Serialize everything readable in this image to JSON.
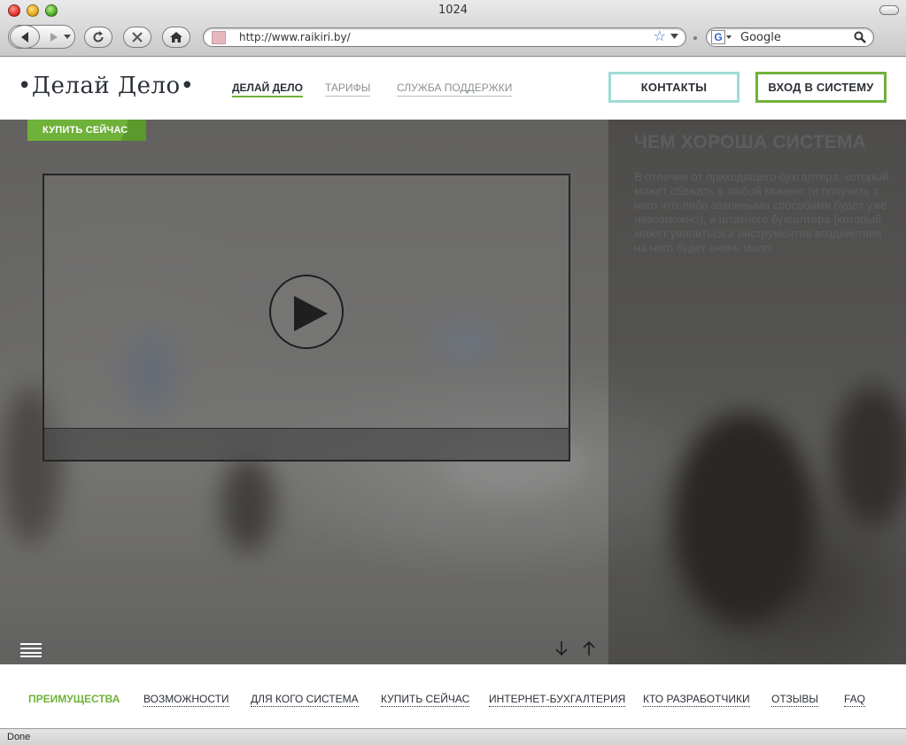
{
  "browser": {
    "window_title": "1024",
    "url": "http://www.raikiri.by/",
    "search_placeholder": "Google",
    "status": "Done"
  },
  "header": {
    "logo": "•Делай Дело•",
    "nav": [
      "ДЕЛАЙ ДЕЛО",
      "ТАРИФЫ",
      "СЛУЖБА ПОДДЕРЖКИ"
    ],
    "contacts_button": "КОНТАКТЫ",
    "login_button": "ВХОД В СИСТЕМУ"
  },
  "hero": {
    "buy_tag": "КУПИТЬ СЕЙЧАС",
    "panel_title": "ЧЕМ ХОРОША СИСТЕМА",
    "panel_text": "В отличие от приходящего бухгалтера, который может сбежать в любой момент (и получить с него что-либо законными способами будет уже невозможно), и штатного бухгалтера (который может уволиться и инструментов воздействия на него будет очень мало."
  },
  "footer_nav": [
    "ПРЕИМУЩЕСТВА",
    "ВОЗМОЖНОСТИ",
    "ДЛЯ КОГО  СИСТЕМА",
    "КУПИТЬ СЕЙЧАС",
    "ИНТЕРНЕТ-БУХГАЛТЕРИЯ",
    "КТО РАЗРАБОТЧИКИ",
    "ОТЗЫВЫ",
    "FAQ"
  ],
  "colors": {
    "accent_green": "#6fb23a",
    "accent_teal": "#9fdbd5",
    "text_dark": "#2b3037"
  }
}
